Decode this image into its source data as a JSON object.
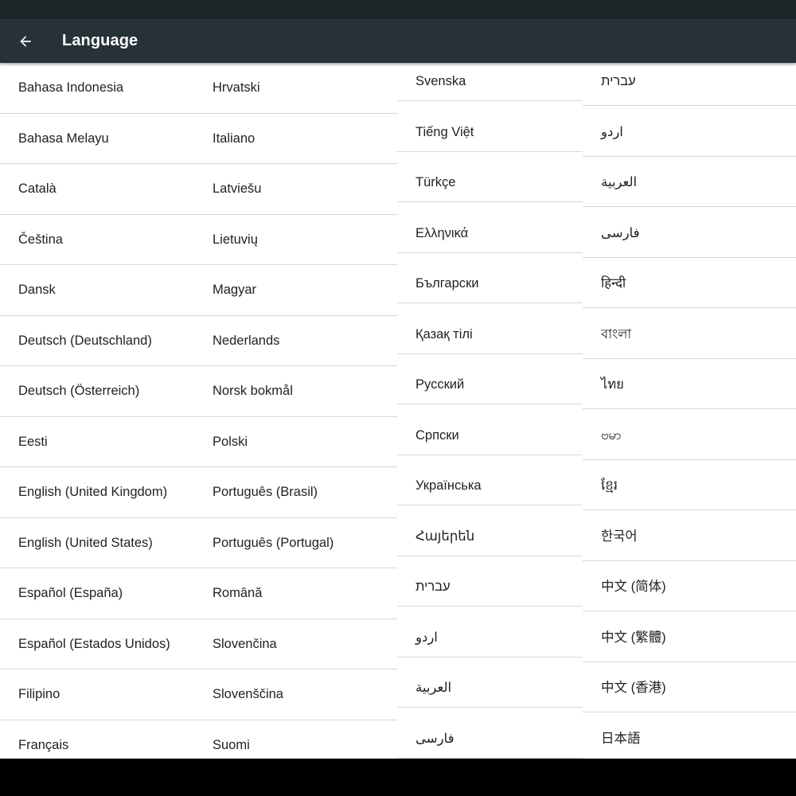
{
  "app_bar": {
    "title": "Language",
    "back_icon": "arrow-back-icon"
  },
  "colors": {
    "status_bar": "#1f2629",
    "app_bar": "#263238",
    "divider": "#d7d7d7",
    "text": "#222222"
  },
  "left_pane": {
    "rows": [
      [
        "Bahasa Indonesia",
        "Hrvatski"
      ],
      [
        "Bahasa Melayu",
        "Italiano"
      ],
      [
        "Català",
        "Latviešu"
      ],
      [
        "Čeština",
        "Lietuvių"
      ],
      [
        "Dansk",
        "Magyar"
      ],
      [
        "Deutsch (Deutschland)",
        "Nederlands"
      ],
      [
        "Deutsch (Österreich)",
        "Norsk bokmål"
      ],
      [
        "Eesti",
        "Polski"
      ],
      [
        "English (United Kingdom)",
        "Português (Brasil)"
      ],
      [
        "English (United States)",
        "Português (Portugal)"
      ],
      [
        "Español (España)",
        "Română"
      ],
      [
        "Español (Estados Unidos)",
        "Slovenčina"
      ],
      [
        "Filipino",
        "Slovenščina"
      ],
      [
        "Français",
        "Suomi"
      ]
    ]
  },
  "right_pane": {
    "rows": [
      [
        "Svenska",
        "עברית"
      ],
      [
        "Tiếng Việt",
        "اردو"
      ],
      [
        "Türkçe",
        "العربية"
      ],
      [
        "Ελληνικά",
        "فارسی"
      ],
      [
        "Български",
        "हिन्दी"
      ],
      [
        "Қазақ тілі",
        "বাংলা"
      ],
      [
        "Русский",
        "ไทย"
      ],
      [
        "Српски",
        "ဗမာ"
      ],
      [
        "Українська",
        "ខ្មែរ"
      ],
      [
        "Հայերեն",
        "한국어"
      ],
      [
        "עברית",
        "中文 (简体)"
      ],
      [
        "اردو",
        "中文 (繁體)"
      ],
      [
        "العربية",
        "中文 (香港)"
      ],
      [
        "فارسی",
        "日本語"
      ]
    ]
  }
}
